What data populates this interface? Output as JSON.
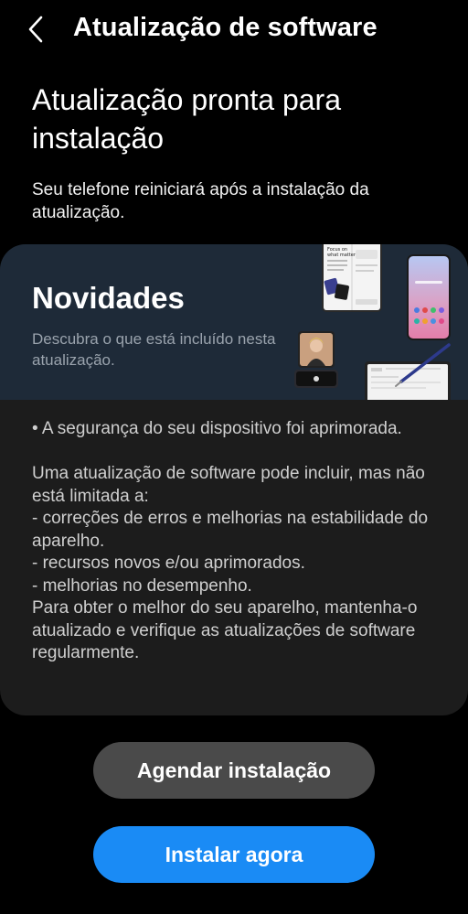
{
  "header": {
    "title": "Atualização de software",
    "back_icon": "chevron-left-icon"
  },
  "heading": "Atualização pronta para instalação",
  "subtitle": "Seu telefone reiniciará após a instalação da atualização.",
  "whats_new": {
    "title": "Novidades",
    "description": "Descubra o que está incluído nesta atualização.",
    "body_line_1": "• A segurança do seu dispositivo foi aprimorada.",
    "body_line_2": "Uma atualização de software pode incluir, mas não está limitada a:\n - correções de erros e melhorias na estabilidade do aparelho.\n - recursos novos e/ou aprimorados.\n - melhorias no desempenho.\nPara obter o melhor do seu aparelho, mantenha-o atualizado e verifique as atualizações de software regularmente.",
    "illustration_text": "Focus on what matters"
  },
  "buttons": {
    "schedule_label": "Agendar instalação",
    "install_label": "Instalar agora"
  },
  "colors": {
    "background": "#000000",
    "card": "#1c1c1c",
    "banner": "#1e2a38",
    "secondary_button": "#4a4a4a",
    "primary_button": "#1a8bf5"
  }
}
